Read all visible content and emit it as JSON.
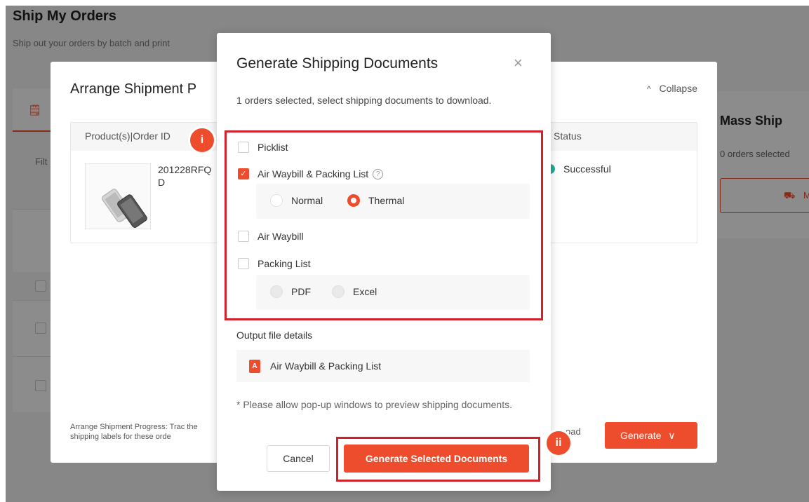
{
  "page": {
    "title": "Ship My Orders",
    "subtitle": "Ship out your orders by batch and print"
  },
  "base": {
    "filter_label": "Filt"
  },
  "mass_ship": {
    "title": "Mass Ship",
    "selected_text": "0 orders selected",
    "button_label": "M"
  },
  "arrange_panel": {
    "title": "Arrange Shipment P",
    "collapse_label": "Collapse",
    "columns": {
      "product": "Product(s)|Order ID",
      "status": "Status"
    },
    "order": {
      "order_id": "201228RFQ D",
      "status": "Successful"
    },
    "progress_text": "Arrange Shipment Progress: Trac the shipping labels for these orde",
    "download_fragment": "oad",
    "generate_label": "Generate"
  },
  "modal": {
    "title": "Generate Shipping Documents",
    "close_icon": "×",
    "description": "1 orders selected, select shipping documents to download.",
    "options": {
      "picklist": {
        "label": "Picklist",
        "checked": false
      },
      "awb_packing": {
        "label": "Air Waybill & Packing List",
        "help_icon": "?",
        "checked": true,
        "formats": [
          {
            "label": "Normal",
            "selected": false
          },
          {
            "label": "Thermal",
            "selected": true
          }
        ]
      },
      "air_waybill": {
        "label": "Air Waybill",
        "checked": false
      },
      "packing_list": {
        "label": "Packing List",
        "checked": false,
        "formats": [
          {
            "label": "PDF",
            "selected": false
          },
          {
            "label": "Excel",
            "selected": false
          }
        ]
      }
    },
    "output_title": "Output file details",
    "output_file": "Air Waybill & Packing List",
    "note": "* Please allow pop-up windows to preview shipping documents.",
    "cancel_label": "Cancel",
    "generate_label": "Generate Selected Documents"
  },
  "annotations": {
    "marker_1": "i",
    "marker_2": "ii"
  },
  "colors": {
    "accent": "#ee4d2d",
    "highlight": "#d0202a",
    "success": "#26aa99"
  },
  "icons": {
    "check": "✓",
    "collapse": "^",
    "dropdown": "∨",
    "pdf": "A",
    "truck": "⛟",
    "tab": "🗒"
  }
}
